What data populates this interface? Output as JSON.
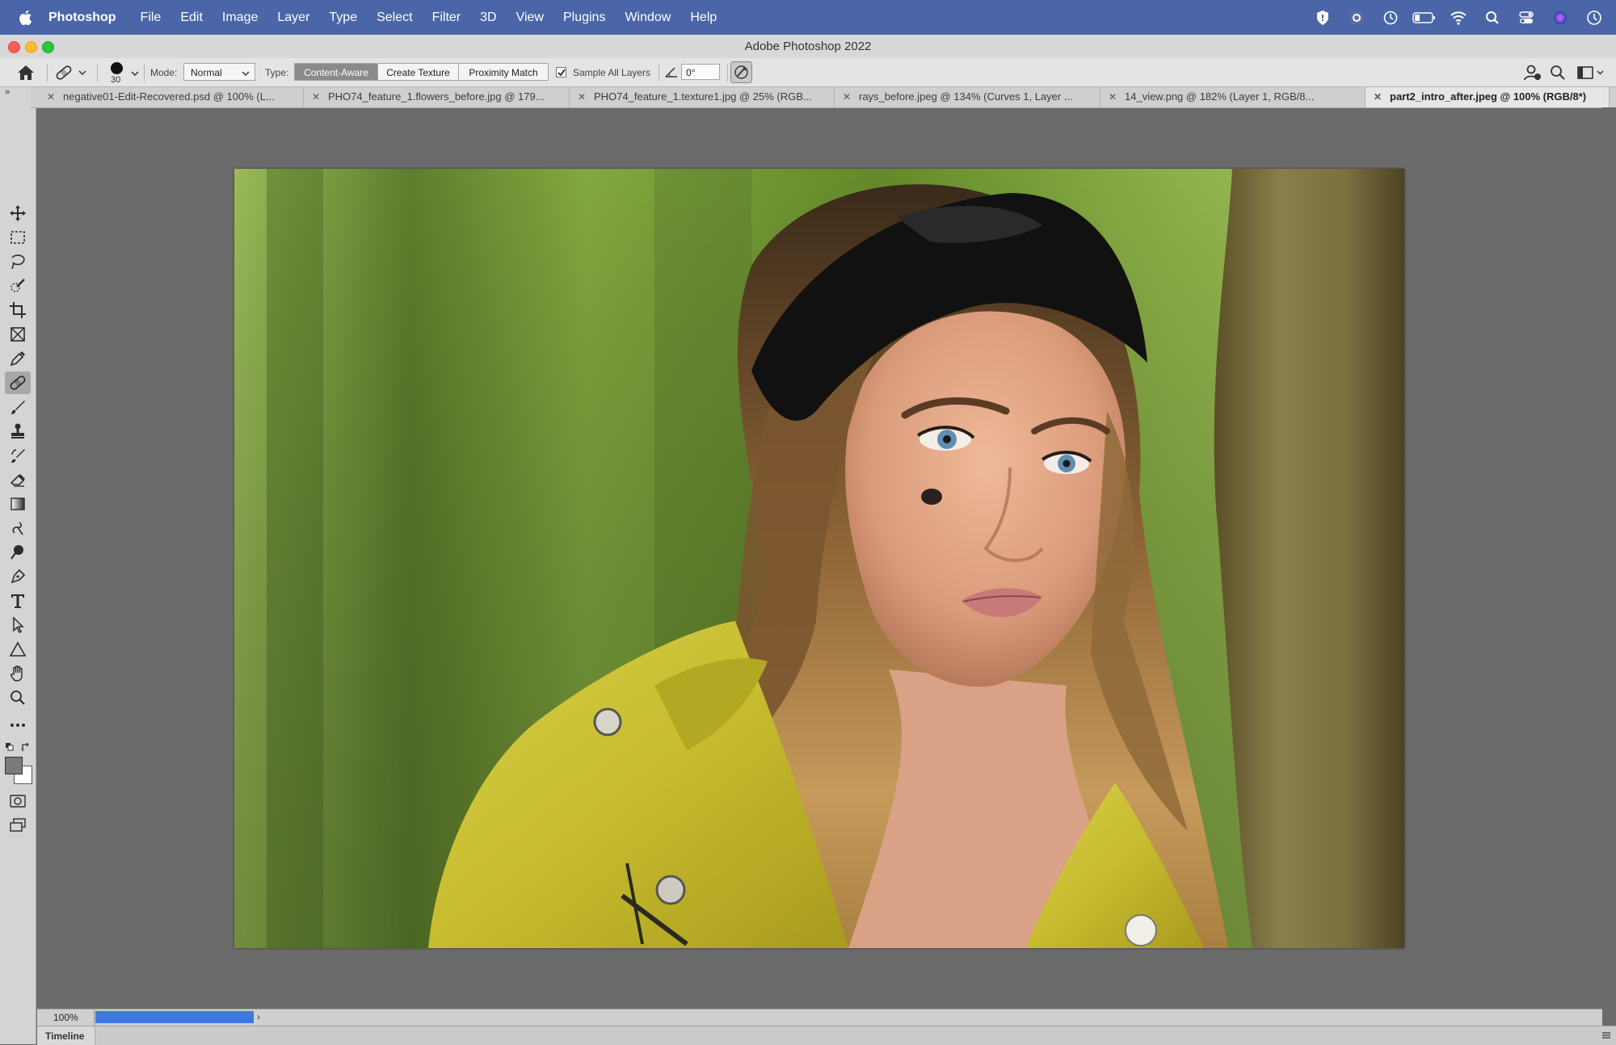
{
  "menubar": {
    "app_name": "Photoshop",
    "items": [
      "File",
      "Edit",
      "Image",
      "Layer",
      "Type",
      "Select",
      "Filter",
      "3D",
      "View",
      "Plugins",
      "Window",
      "Help"
    ]
  },
  "window": {
    "title": "Adobe Photoshop 2022"
  },
  "options": {
    "brush_size": "30",
    "mode_label": "Mode:",
    "mode_value": "Normal",
    "type_label": "Type:",
    "type_buttons": [
      "Content-Aware",
      "Create Texture",
      "Proximity Match"
    ],
    "active_type": "Content-Aware",
    "sample_all_layers_label": "Sample All Layers",
    "sample_all_layers_checked": true,
    "angle_value": "0°"
  },
  "tabs": [
    {
      "label": "negative01-Edit-Recovered.psd @ 100% (L..."
    },
    {
      "label": "PHO74_feature_1.flowers_before.jpg @ 179..."
    },
    {
      "label": "PHO74_feature_1.texture1.jpg @ 25% (RGB..."
    },
    {
      "label": "rays_before.jpeg @ 134% (Curves 1, Layer ..."
    },
    {
      "label": "14_view.png @ 182% (Layer 1, RGB/8..."
    },
    {
      "label": "part2_intro_after.jpeg @ 100% (RGB/8*)"
    }
  ],
  "active_tab": "part2_intro_after.jpeg @ 100% (RGB/8*)",
  "tools": [
    "move-tool",
    "marquee-tool",
    "lasso-tool",
    "quick-selection-tool",
    "crop-tool",
    "frame-tool",
    "eyedropper-tool",
    "spot-healing-brush-tool",
    "brush-tool",
    "clone-stamp-tool",
    "history-brush-tool",
    "eraser-tool",
    "gradient-tool",
    "blur-tool",
    "dodge-tool",
    "pen-tool",
    "type-tool",
    "path-selection-tool",
    "shape-tool",
    "hand-tool",
    "zoom-tool",
    "edit-toolbar",
    "quick-mask",
    "screen-mode"
  ],
  "selected_tool": "spot-healing-brush-tool",
  "status": {
    "zoom": "100%"
  },
  "timeline": {
    "label": "Timeline"
  },
  "colors": {
    "menubar": "#4a66a8",
    "foreground": "#7a7a7a",
    "background": "#ffffff",
    "progress": "#3c78e0"
  }
}
